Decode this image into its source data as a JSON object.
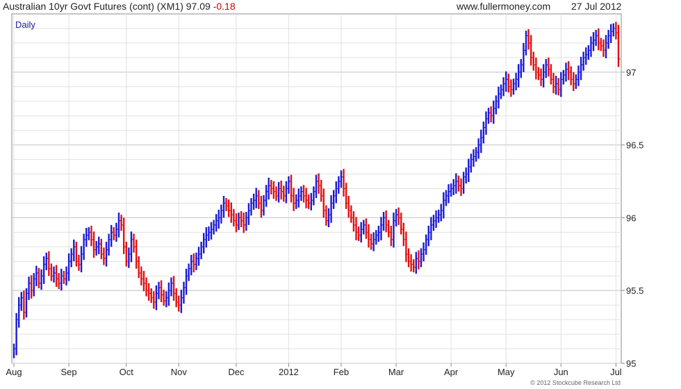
{
  "header": {
    "instrument": "Australian 10yr Govt Futures (cont) (XM1)",
    "last": "97.09",
    "change": "-0.18",
    "site": "www.fullermoney.com",
    "date": "27 Jul 2012"
  },
  "period_label": "Daily",
  "credit": "© 2012 Stockcube Research Ltd",
  "colors": {
    "up": "#1a1ad6",
    "down": "#e01010",
    "grid": "#e0e0e0",
    "axis": "#888888"
  },
  "chart_data": {
    "type": "line",
    "style": "hlc-bars",
    "grid": true,
    "ylim": [
      95,
      97.4
    ],
    "yticks": [
      {
        "value": 95,
        "label": "95"
      },
      {
        "value": 95.5,
        "label": "95.5"
      },
      {
        "value": 96,
        "label": "96"
      },
      {
        "value": 96.5,
        "label": "96.5"
      },
      {
        "value": 97,
        "label": "97"
      }
    ],
    "xticks": [
      "Aug",
      "Sep",
      "Oct",
      "Nov",
      "Dec",
      "2012",
      "Feb",
      "Mar",
      "Apr",
      "May",
      "Jun",
      "Jul"
    ],
    "xtick_pos": [
      0,
      22,
      45,
      66,
      89,
      110,
      131,
      153,
      175,
      197,
      219,
      241
    ],
    "series": [
      {
        "close": [
          95.1,
          95.3,
          95.4,
          95.45,
          95.35,
          95.48,
          95.55,
          95.5,
          95.58,
          95.62,
          95.55,
          95.6,
          95.68,
          95.72,
          95.65,
          95.6,
          95.62,
          95.58,
          95.55,
          95.6,
          95.58,
          95.62,
          95.7,
          95.75,
          95.8,
          95.7,
          95.68,
          95.75,
          95.85,
          95.88,
          95.9,
          95.85,
          95.78,
          95.8,
          95.82,
          95.75,
          95.72,
          95.78,
          95.85,
          95.9,
          95.88,
          95.92,
          95.98,
          95.95,
          95.8,
          95.7,
          95.75,
          95.85,
          95.8,
          95.7,
          95.62,
          95.58,
          95.55,
          95.5,
          95.48,
          95.45,
          95.42,
          95.48,
          95.52,
          95.47,
          95.43,
          95.45,
          95.5,
          95.55,
          95.48,
          95.42,
          95.4,
          95.45,
          95.52,
          95.6,
          95.65,
          95.7,
          95.68,
          95.72,
          95.75,
          95.8,
          95.85,
          95.88,
          95.9,
          95.92,
          95.95,
          95.98,
          96.0,
          96.05,
          96.1,
          96.08,
          96.05,
          96.02,
          95.98,
          95.95,
          96.0,
          95.98,
          95.95,
          96.0,
          96.05,
          96.1,
          96.12,
          96.15,
          96.1,
          96.05,
          96.12,
          96.18,
          96.22,
          96.2,
          96.18,
          96.15,
          96.2,
          96.18,
          96.15,
          96.2,
          96.25,
          96.15,
          96.1,
          96.12,
          96.15,
          96.18,
          96.15,
          96.12,
          96.1,
          96.12,
          96.18,
          96.25,
          96.22,
          96.15,
          96.05,
          95.98,
          96.02,
          96.1,
          96.15,
          96.2,
          96.25,
          96.28,
          96.2,
          96.1,
          96.05,
          96.0,
          95.95,
          95.9,
          95.88,
          95.92,
          95.95,
          95.9,
          95.85,
          95.82,
          95.85,
          95.88,
          95.9,
          95.95,
          96.0,
          95.95,
          95.9,
          95.85,
          95.98,
          96.02,
          96.0,
          95.92,
          95.85,
          95.75,
          95.7,
          95.68,
          95.66,
          95.72,
          95.7,
          95.75,
          95.78,
          95.85,
          95.9,
          95.95,
          95.98,
          96.0,
          96.02,
          96.05,
          96.12,
          96.15,
          96.18,
          96.2,
          96.22,
          96.25,
          96.22,
          96.2,
          96.28,
          96.3,
          96.35,
          96.4,
          96.42,
          96.45,
          96.5,
          96.55,
          96.62,
          96.68,
          96.72,
          96.7,
          96.75,
          96.8,
          96.85,
          96.88,
          96.92,
          96.95,
          96.9,
          96.88,
          96.92,
          96.95,
          97.0,
          97.05,
          97.15,
          97.25,
          97.2,
          97.1,
          97.05,
          97.0,
          96.98,
          96.95,
          97.0,
          97.05,
          97.02,
          96.95,
          96.9,
          96.92,
          96.88,
          96.95,
          96.98,
          97.02,
          97.0,
          96.95,
          96.92,
          96.95,
          97.0,
          97.05,
          97.1,
          97.12,
          97.15,
          97.2,
          97.22,
          97.25,
          97.2,
          97.18,
          97.15,
          97.2,
          97.25,
          97.28,
          97.3,
          97.27,
          97.09
        ]
      }
    ]
  }
}
